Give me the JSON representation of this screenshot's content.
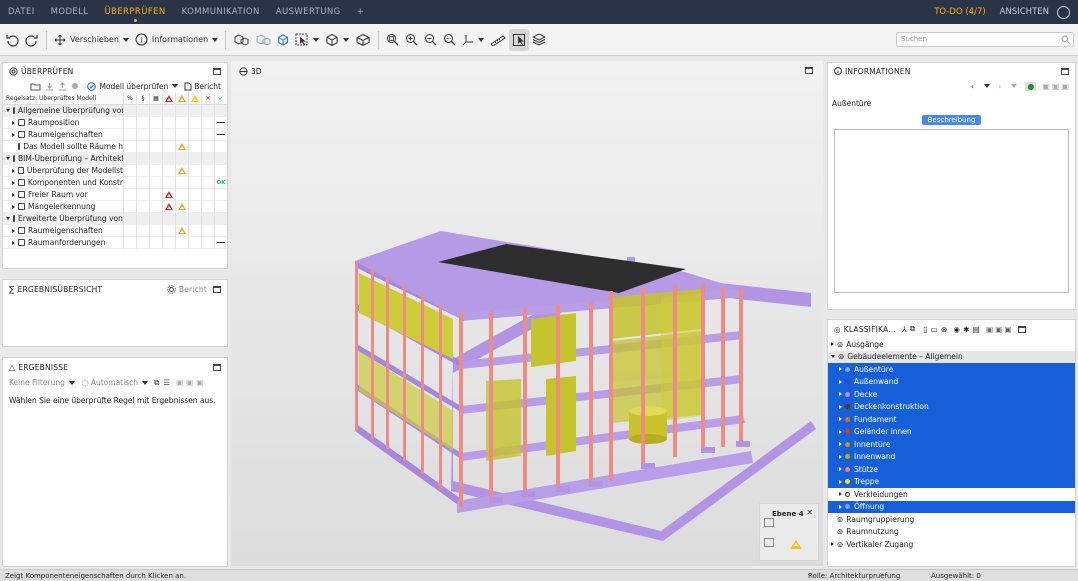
{
  "menu": {
    "items": [
      "DATEI",
      "MODELL",
      "ÜBERPRÜFEN",
      "KOMMUNIKATION",
      "AUSWERTUNG",
      "+"
    ],
    "active_index": 2,
    "todo": "TO-DO (4/7)",
    "ansichten": "ANSICHTEN"
  },
  "toolbar": {
    "move_label": "Verschieben",
    "info_label": "Informationen",
    "search_placeholder": "Suchen"
  },
  "check_panel": {
    "title": "ÜBERPRÜFEN",
    "check_model_label": "Modell überprüfen",
    "report_label": "Bericht",
    "ruleset_label": "Regelsatz: Überprüftes Modell",
    "rows": [
      {
        "name": "Allgemeine Überprüfung von",
        "level": 0,
        "expand": "open",
        "group": true,
        "mark": ""
      },
      {
        "name": "Raumposition",
        "level": 1,
        "expand": "closed",
        "group": false,
        "mark": "dash"
      },
      {
        "name": "Raumeigenschaften",
        "level": 1,
        "expand": "closed",
        "group": false,
        "mark": "dash"
      },
      {
        "name": "Das Modell sollte Räume h",
        "level": 2,
        "expand": "none",
        "group": false,
        "mark": "warn-orange"
      },
      {
        "name": "BIM-Überprüfung – Architekt",
        "level": 0,
        "expand": "open",
        "group": true,
        "mark": ""
      },
      {
        "name": "Überprüfung der Modellst",
        "level": 1,
        "expand": "closed",
        "group": false,
        "mark": "warn-orange"
      },
      {
        "name": "Komponenten und Konstr",
        "level": 1,
        "expand": "closed",
        "group": false,
        "mark": "ok"
      },
      {
        "name": "Freier Raum vor",
        "level": 1,
        "expand": "closed",
        "group": false,
        "mark": "warn-red"
      },
      {
        "name": "Mängelerkennung",
        "level": 1,
        "expand": "closed",
        "group": false,
        "mark": "warn-both"
      },
      {
        "name": "Erweiterte Überprüfung von R",
        "level": 0,
        "expand": "open",
        "group": true,
        "mark": ""
      },
      {
        "name": "Raumeigenschaften",
        "level": 1,
        "expand": "closed",
        "group": false,
        "mark": "warn-orange"
      },
      {
        "name": "Raumanforderungen",
        "level": 1,
        "expand": "closed",
        "group": false,
        "mark": "dash"
      }
    ],
    "ok_text": "OK"
  },
  "summary_panel": {
    "title": "ERGEBNISÜBERSICHT",
    "report_label": "Bericht"
  },
  "results_panel": {
    "title": "ERGEBNISSE",
    "filter_label": "Keine Filterung",
    "auto_label": "Automatisch",
    "empty_message": "Wählen Sie eine überprüfte Regel mit Ergebnissen aus."
  },
  "viewport": {
    "label": "3D",
    "level_label": "Ebene 4"
  },
  "info_panel": {
    "title": "INFORMATIONEN",
    "object_name": "Außentüre",
    "tab_label": "Beschreibung"
  },
  "class_panel": {
    "title": "KLASSIFIKA...",
    "items": [
      {
        "label": "Ausgänge",
        "level": 0,
        "expand": "closed",
        "selected": false,
        "dot": ""
      },
      {
        "label": "Gebäudeelemente – Allgemein",
        "level": 0,
        "expand": "open",
        "selected": false,
        "dot": "",
        "group": true
      },
      {
        "label": "Außentüre",
        "level": 1,
        "expand": "closed",
        "selected": true,
        "dot": "#7ea6f0"
      },
      {
        "label": "Außenwand",
        "level": 1,
        "expand": "closed",
        "selected": true,
        "dot": "#2c4ad0"
      },
      {
        "label": "Decke",
        "level": 1,
        "expand": "closed",
        "selected": true,
        "dot": "#b38cf0"
      },
      {
        "label": "Deckenkonstruktion",
        "level": 1,
        "expand": "closed",
        "selected": true,
        "dot": "#553c10"
      },
      {
        "label": "Fundament",
        "level": 1,
        "expand": "closed",
        "selected": true,
        "dot": "#f06a14"
      },
      {
        "label": "Geländer innen",
        "level": 1,
        "expand": "closed",
        "selected": true,
        "dot": "#ea3a10"
      },
      {
        "label": "Innentüre",
        "level": 1,
        "expand": "closed",
        "selected": true,
        "dot": "#c99410"
      },
      {
        "label": "Innenwand",
        "level": 1,
        "expand": "closed",
        "selected": true,
        "dot": "#b9b00c"
      },
      {
        "label": "Stütze",
        "level": 1,
        "expand": "closed",
        "selected": true,
        "dot": "#f07a8c"
      },
      {
        "label": "Treppe",
        "level": 1,
        "expand": "closed",
        "selected": true,
        "dot": "#f4e410"
      },
      {
        "label": "Verkleidungen",
        "level": 1,
        "expand": "closed",
        "selected": false,
        "dot": "#ffffff"
      },
      {
        "label": "Öffnung",
        "level": 1,
        "expand": "closed",
        "selected": true,
        "dot": "#7aa0ee"
      },
      {
        "label": "Raumgruppierung",
        "level": 0,
        "expand": "none",
        "selected": false,
        "dot": ""
      },
      {
        "label": "Raumnutzung",
        "level": 0,
        "expand": "none",
        "selected": false,
        "dot": ""
      },
      {
        "label": "Vertikaler Zugang",
        "level": 0,
        "expand": "closed",
        "selected": false,
        "dot": ""
      }
    ]
  },
  "status": {
    "hint": "Zeigt Komponenteneigenschaften durch Klicken an.",
    "role": "Rolle: Architekturpruefung",
    "selected": "Ausgewählt: 0"
  },
  "colors": {
    "menu_bg": "#2a3446",
    "accent": "#f6b21b",
    "selection": "#1560d8",
    "slab": "#b79be8",
    "column": "#ef8b86",
    "wall": "#c7c52e",
    "roof": "#2d2d2d"
  }
}
